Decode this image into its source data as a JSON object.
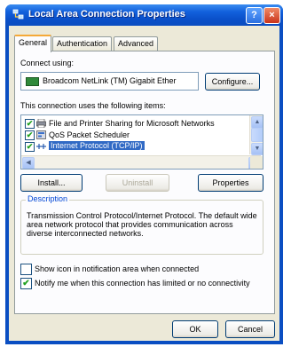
{
  "window": {
    "title": "Local Area Connection Properties",
    "help_label": "?",
    "close_label": "×"
  },
  "tabs": [
    {
      "label": "General",
      "active": true
    },
    {
      "label": "Authentication",
      "active": false
    },
    {
      "label": "Advanced",
      "active": false
    }
  ],
  "connect_using": {
    "label": "Connect using:",
    "adapter": "Broadcom NetLink (TM) Gigabit Ether",
    "configure_button": "Configure..."
  },
  "items": {
    "label": "This connection uses the following items:",
    "list": [
      {
        "text": "File and Printer Sharing for Microsoft Networks",
        "checked": true,
        "icon": "printer-icon"
      },
      {
        "text": "QoS Packet Scheduler",
        "checked": true,
        "icon": "scheduler-icon"
      },
      {
        "text": "Internet Protocol (TCP/IP)",
        "checked": true,
        "icon": "network-protocol-icon",
        "selected": true
      }
    ]
  },
  "actions": {
    "install": "Install...",
    "uninstall": "Uninstall",
    "properties": "Properties"
  },
  "description": {
    "title": "Description",
    "text": "Transmission Control Protocol/Internet Protocol. The default wide area network protocol that provides communication across diverse interconnected networks."
  },
  "options": [
    {
      "label": "Show icon in notification area when connected",
      "checked": false
    },
    {
      "label": "Notify me when this connection has limited or no connectivity",
      "checked": true
    }
  ],
  "dialog_buttons": {
    "ok": "OK",
    "cancel": "Cancel"
  },
  "colors": {
    "title_bar": "#0a4ec2",
    "dialog_bg": "#ece9d8",
    "selection": "#316ac5",
    "group_title": "#0046d5"
  }
}
